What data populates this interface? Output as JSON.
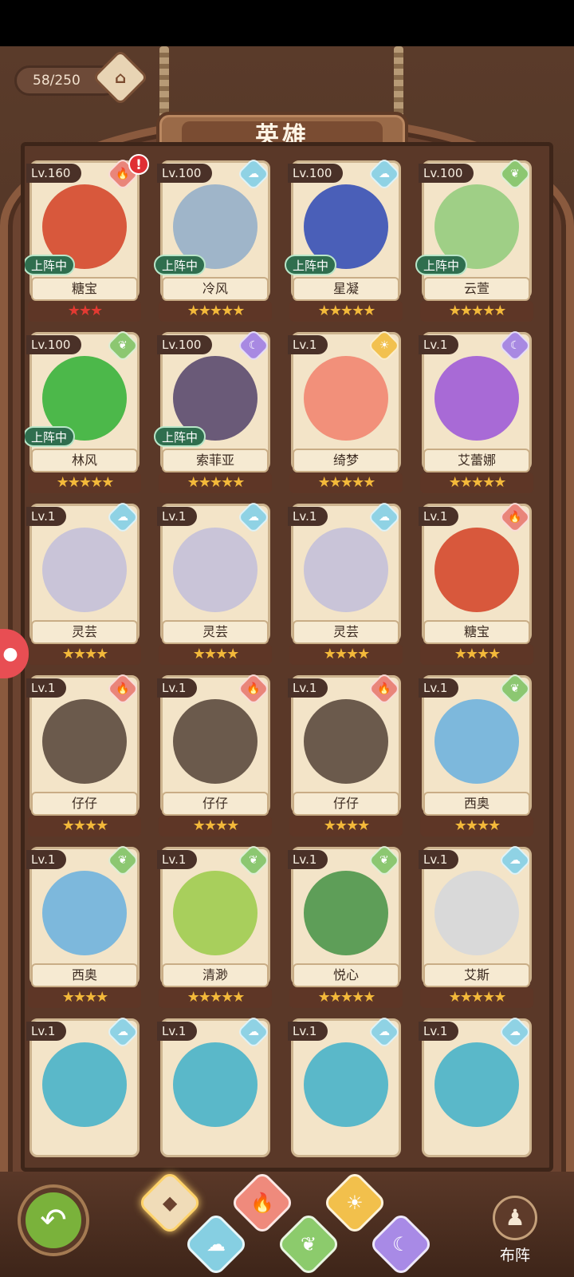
{
  "header": {
    "title": "英雄",
    "counter": "58/250"
  },
  "cards": [
    {
      "lv": "Lv.160",
      "element": "fire",
      "name": "糖宝",
      "deployed": true,
      "alert": true,
      "stars": "★★★",
      "star_color": "red",
      "art": "#d8583c"
    },
    {
      "lv": "Lv.100",
      "element": "water",
      "name": "冷风",
      "deployed": true,
      "alert": false,
      "stars": "★★★★★",
      "star_color": "gold",
      "art": "#9fb5c9"
    },
    {
      "lv": "Lv.100",
      "element": "water",
      "name": "星凝",
      "deployed": true,
      "alert": false,
      "stars": "★★★★★",
      "star_color": "gold",
      "art": "#4a5fb8"
    },
    {
      "lv": "Lv.100",
      "element": "grass",
      "name": "云萱",
      "deployed": true,
      "alert": false,
      "stars": "★★★★★",
      "star_color": "gold",
      "art": "#9fcf86"
    },
    {
      "lv": "Lv.100",
      "element": "grass",
      "name": "林风",
      "deployed": true,
      "alert": false,
      "stars": "★★★★★",
      "star_color": "gold",
      "art": "#4cb84a"
    },
    {
      "lv": "Lv.100",
      "element": "dark",
      "name": "索菲亚",
      "deployed": true,
      "alert": false,
      "stars": "★★★★★",
      "star_color": "gold",
      "art": "#6a5a78"
    },
    {
      "lv": "Lv.1",
      "element": "light",
      "name": "绮梦",
      "deployed": false,
      "alert": false,
      "stars": "★★★★★",
      "star_color": "gold",
      "art": "#f2907a"
    },
    {
      "lv": "Lv.1",
      "element": "dark",
      "name": "艾蕾娜",
      "deployed": false,
      "alert": false,
      "stars": "★★★★★",
      "star_color": "gold",
      "art": "#a86ad6"
    },
    {
      "lv": "Lv.1",
      "element": "water",
      "name": "灵芸",
      "deployed": false,
      "alert": false,
      "stars": "★★★★",
      "star_color": "gold",
      "art": "#c9c4d8"
    },
    {
      "lv": "Lv.1",
      "element": "water",
      "name": "灵芸",
      "deployed": false,
      "alert": false,
      "stars": "★★★★",
      "star_color": "gold",
      "art": "#c9c4d8"
    },
    {
      "lv": "Lv.1",
      "element": "water",
      "name": "灵芸",
      "deployed": false,
      "alert": false,
      "stars": "★★★★",
      "star_color": "gold",
      "art": "#c9c4d8"
    },
    {
      "lv": "Lv.1",
      "element": "fire",
      "name": "糖宝",
      "deployed": false,
      "alert": false,
      "stars": "★★★★",
      "star_color": "gold",
      "art": "#d8583c"
    },
    {
      "lv": "Lv.1",
      "element": "fire",
      "name": "仔仔",
      "deployed": false,
      "alert": false,
      "stars": "★★★★",
      "star_color": "gold",
      "art": "#6b5a4c"
    },
    {
      "lv": "Lv.1",
      "element": "fire",
      "name": "仔仔",
      "deployed": false,
      "alert": false,
      "stars": "★★★★",
      "star_color": "gold",
      "art": "#6b5a4c"
    },
    {
      "lv": "Lv.1",
      "element": "fire",
      "name": "仔仔",
      "deployed": false,
      "alert": false,
      "stars": "★★★★",
      "star_color": "gold",
      "art": "#6b5a4c"
    },
    {
      "lv": "Lv.1",
      "element": "grass",
      "name": "西奥",
      "deployed": false,
      "alert": false,
      "stars": "★★★★",
      "star_color": "gold",
      "art": "#7db8dc"
    },
    {
      "lv": "Lv.1",
      "element": "grass",
      "name": "西奥",
      "deployed": false,
      "alert": false,
      "stars": "★★★★",
      "star_color": "gold",
      "art": "#7db8dc"
    },
    {
      "lv": "Lv.1",
      "element": "grass",
      "name": "清渺",
      "deployed": false,
      "alert": false,
      "stars": "★★★★★",
      "star_color": "gold",
      "art": "#a8cf5c"
    },
    {
      "lv": "Lv.1",
      "element": "grass",
      "name": "悦心",
      "deployed": false,
      "alert": false,
      "stars": "★★★★★",
      "star_color": "gold",
      "art": "#5e9e58"
    },
    {
      "lv": "Lv.1",
      "element": "water",
      "name": "艾斯",
      "deployed": false,
      "alert": false,
      "stars": "★★★★★",
      "star_color": "gold",
      "art": "#d9d9d9"
    },
    {
      "lv": "Lv.1",
      "element": "water",
      "name": "",
      "deployed": false,
      "alert": false,
      "stars": "",
      "star_color": "gold",
      "art": "#5ab8c9"
    },
    {
      "lv": "Lv.1",
      "element": "water",
      "name": "",
      "deployed": false,
      "alert": false,
      "stars": "",
      "star_color": "gold",
      "art": "#5ab8c9"
    },
    {
      "lv": "Lv.1",
      "element": "water",
      "name": "",
      "deployed": false,
      "alert": false,
      "stars": "",
      "star_color": "gold",
      "art": "#5ab8c9"
    },
    {
      "lv": "Lv.1",
      "element": "water",
      "name": "",
      "deployed": false,
      "alert": false,
      "stars": "",
      "star_color": "gold",
      "art": "#5ab8c9"
    }
  ],
  "labels": {
    "deployed": "上阵中",
    "alert": "!"
  },
  "bottom": {
    "formation_label": "布阵",
    "filters": [
      "all",
      "water",
      "fire",
      "grass",
      "light",
      "dark"
    ]
  },
  "icons": {
    "fire": "🔥",
    "water": "☁",
    "grass": "❦",
    "light": "☀",
    "dark": "☾",
    "all": "◆",
    "back": "↶",
    "formation": "♟",
    "counter": "⌂",
    "side": "●"
  }
}
